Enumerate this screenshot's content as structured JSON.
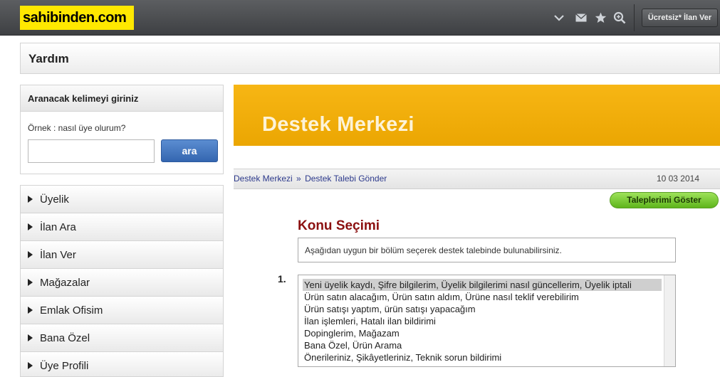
{
  "topbar": {
    "logo": "sahibinden.com",
    "post_button": "Ücretsiz* İlan Ver",
    "icons": [
      "chevron-down-icon",
      "mail-icon",
      "star-icon",
      "search-zoom-icon"
    ]
  },
  "page": {
    "title": "Yardım"
  },
  "search": {
    "heading": "Aranacak kelimeyi giriniz",
    "hint": "Örnek : nasıl üye olurum?",
    "value": "",
    "button": "ara"
  },
  "menu": {
    "items": [
      {
        "label": "Üyelik"
      },
      {
        "label": "İlan Ara"
      },
      {
        "label": "İlan Ver"
      },
      {
        "label": "Mağazalar"
      },
      {
        "label": "Emlak Ofisim"
      },
      {
        "label": "Bana Özel"
      },
      {
        "label": "Üye Profili"
      }
    ]
  },
  "banner": {
    "title": "Destek Merkezi"
  },
  "breadcrumb": {
    "home": "Destek Merkezi",
    "separator": "»",
    "current": "Destek Talebi Gönder",
    "date": "10 03 2014"
  },
  "requests_button": "Taleplerimi Göster",
  "topic": {
    "title": "Konu Seçimi",
    "description": "Aşağıdan uygun bir bölüm seçerek destek talebinde bulunabilirsiniz.",
    "step_number": "1.",
    "options": [
      "Yeni üyelik kaydı, Şifre bilgilerim, Üyelik bilgilerimi nasıl güncellerim, Üyelik iptali",
      "Ürün satın alacağım, Ürün satın aldım, Ürüne nasıl teklif verebilirim",
      "Ürün satışı yaptım, ürün satışı yapacağım",
      "İlan işlemleri, Hatalı ilan bildirimi",
      "Dopinglerim, Mağazam",
      "Bana Özel, Ürün Arama",
      "Önerileriniz, Şikâyetleriniz, Teknik sorun bildirimi"
    ],
    "selected_index": 0
  },
  "colors": {
    "topbar": "#4a4c4f",
    "logo_bg": "#ffe800",
    "banner": "#f2ad08",
    "search_button": "#3f72bd",
    "requests_button": "#7ccb35",
    "topic_title": "#8b1010",
    "link": "#2d3a8c"
  }
}
